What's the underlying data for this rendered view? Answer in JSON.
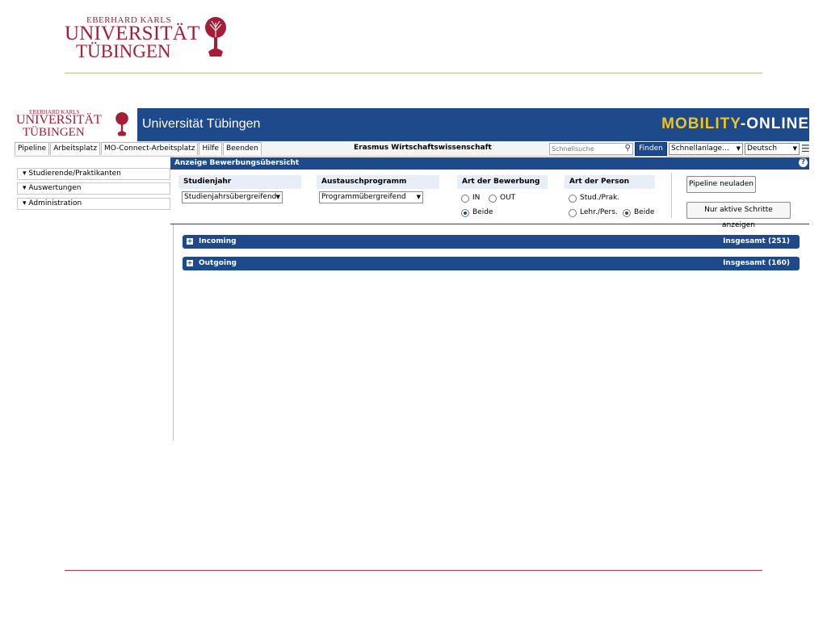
{
  "slide_logo": {
    "line1": "EBERHARD KARLS",
    "line2": "UNIVERSITÄT",
    "line3": "TÜBINGEN"
  },
  "banner": {
    "logo_line1": "EBERHARD KARLS",
    "logo_line2": "UNIVERSITÄT",
    "logo_line3": "TÜBINGEN",
    "title": "Universität Tübingen",
    "product_part1": "MOBILITY",
    "product_part2": "-ONLINE"
  },
  "toolbar": {
    "tabs": [
      "Pipeline",
      "Arbeitsplatz",
      "MO-Connect-Arbeitsplatz",
      "Hilfe",
      "Beenden"
    ],
    "center_title": "Erasmus Wirtschaftswissenschaft",
    "search_placeholder": "Schnellsuche",
    "find_label": "Finden",
    "quick_create_value": "Schnellanlage...",
    "language_value": "Deutsch"
  },
  "sidebar": {
    "items": [
      "Studierende/Praktikanten",
      "Auswertungen",
      "Administration"
    ]
  },
  "main": {
    "header": "Anzeige Bewerbungsübersicht",
    "studienjahr": {
      "label": "Studienjahr",
      "value": "Studienjahrsübergreifend"
    },
    "austausch": {
      "label": "Austauschprogramm",
      "value": "Programmübergreifend"
    },
    "art_bewerbung": {
      "label": "Art der Bewerbung",
      "options": [
        "IN",
        "OUT",
        "Beide"
      ],
      "selected": "Beide"
    },
    "art_person": {
      "label": "Art der Person",
      "options": [
        "Stud./Prak.",
        "Lehr./Pers.",
        "Beide"
      ],
      "selected": "Beide"
    },
    "btn_reload": "Pipeline neuladen",
    "btn_active": "Nur aktive Schritte anzeigen",
    "sections": [
      {
        "label": "Incoming",
        "total": "Insgesamt (251)"
      },
      {
        "label": "Outgoing",
        "total": "Insgesamt (160)"
      }
    ]
  },
  "colors": {
    "uni_red": "#a51e36",
    "header_blue": "#1e4a8c",
    "mobility_yellow": "#f0c419"
  }
}
